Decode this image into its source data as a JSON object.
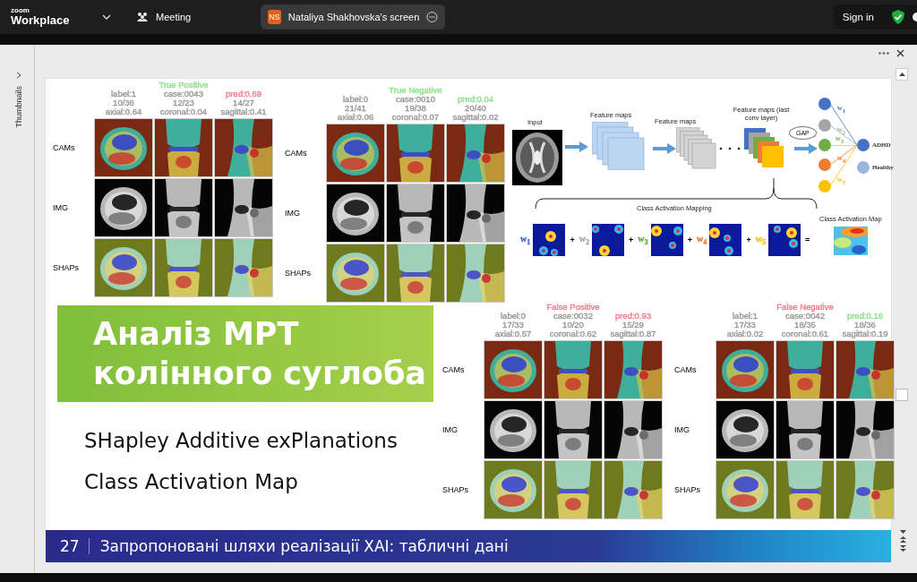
{
  "app_bar": {
    "logo_top": "zoom",
    "logo_bottom": "Workplace",
    "meeting": "Meeting",
    "share": {
      "initials": "NS",
      "label": "Nataliya Shakhovska's screen"
    },
    "sign_in": "Sign in"
  },
  "viewer": {
    "thumbnails": "Thumbnails"
  },
  "slide": {
    "panels": [
      {
        "columns": [
          {
            "lines": [
              {
                "text": "label:1",
                "color": "#9a9a9a"
              },
              {
                "text": "10/36",
                "color": "#9a9a9a"
              },
              {
                "text": "axial:0.64",
                "color": "#9a9a9a"
              }
            ]
          },
          {
            "lines": [
              {
                "text": "True Positive",
                "color": "#8ee08e"
              },
              {
                "text": "case:0043",
                "color": "#9a9a9a"
              },
              {
                "text": "12/23",
                "color": "#9a9a9a"
              },
              {
                "text": "coronal:0.04",
                "color": "#9a9a9a"
              }
            ]
          },
          {
            "lines": [
              {
                "text": "pred:0.69",
                "color": "#f27d8c"
              },
              {
                "text": "14/27",
                "color": "#9a9a9a"
              },
              {
                "text": "sagittal:0.41",
                "color": "#9a9a9a"
              }
            ]
          }
        ],
        "rows": [
          {
            "label": "CAMs",
            "kind": "cam"
          },
          {
            "label": "IMG",
            "kind": "img"
          },
          {
            "label": "SHAPs",
            "kind": "shap"
          }
        ]
      },
      {
        "columns": [
          {
            "lines": [
              {
                "text": "label:0",
                "color": "#9a9a9a"
              },
              {
                "text": "21/41",
                "color": "#9a9a9a"
              },
              {
                "text": "axial:0.06",
                "color": "#9a9a9a"
              }
            ]
          },
          {
            "lines": [
              {
                "text": "True Negative",
                "color": "#8ee08e"
              },
              {
                "text": "case:0010",
                "color": "#9a9a9a"
              },
              {
                "text": "19/38",
                "color": "#9a9a9a"
              },
              {
                "text": "coronal:0.07",
                "color": "#9a9a9a"
              }
            ]
          },
          {
            "lines": [
              {
                "text": "pred:0.04",
                "color": "#8ee08e"
              },
              {
                "text": "20/40",
                "color": "#9a9a9a"
              },
              {
                "text": "sagittal:0.02",
                "color": "#9a9a9a"
              }
            ]
          }
        ],
        "rows": [
          {
            "label": "CAMs",
            "kind": "cam"
          },
          {
            "label": "IMG",
            "kind": "img"
          },
          {
            "label": "SHAPs",
            "kind": "shap"
          }
        ]
      },
      {
        "columns": [
          {
            "lines": [
              {
                "text": "label:0",
                "color": "#9a9a9a"
              },
              {
                "text": "17/33",
                "color": "#9a9a9a"
              },
              {
                "text": "axial:0.57",
                "color": "#9a9a9a"
              }
            ]
          },
          {
            "lines": [
              {
                "text": "False Positive",
                "color": "#f27d8c"
              },
              {
                "text": "case:0032",
                "color": "#9a9a9a"
              },
              {
                "text": "10/20",
                "color": "#9a9a9a"
              },
              {
                "text": "coronal:0.62",
                "color": "#9a9a9a"
              }
            ]
          },
          {
            "lines": [
              {
                "text": "pred:0.93",
                "color": "#f27d8c"
              },
              {
                "text": "15/29",
                "color": "#9a9a9a"
              },
              {
                "text": "sagittal:0.87",
                "color": "#9a9a9a"
              }
            ]
          }
        ],
        "rows": [
          {
            "label": "CAMs",
            "kind": "cam"
          },
          {
            "label": "IMG",
            "kind": "img"
          },
          {
            "label": "SHAPs",
            "kind": "shap"
          }
        ]
      },
      {
        "columns": [
          {
            "lines": [
              {
                "text": "label:1",
                "color": "#9a9a9a"
              },
              {
                "text": "17/33",
                "color": "#9a9a9a"
              },
              {
                "text": "axial:0.02",
                "color": "#9a9a9a"
              }
            ]
          },
          {
            "lines": [
              {
                "text": "False Negative",
                "color": "#f27d8c"
              },
              {
                "text": "case:0042",
                "color": "#9a9a9a"
              },
              {
                "text": "18/35",
                "color": "#9a9a9a"
              },
              {
                "text": "coronal:0.61",
                "color": "#9a9a9a"
              }
            ]
          },
          {
            "lines": [
              {
                "text": "pred:0.16",
                "color": "#8ee08e"
              },
              {
                "text": "18/36",
                "color": "#9a9a9a"
              },
              {
                "text": "sagittal:0.19",
                "color": "#9a9a9a"
              }
            ]
          }
        ],
        "rows": [
          {
            "label": "CAMs",
            "kind": "cam"
          },
          {
            "label": "IMG",
            "kind": "img"
          },
          {
            "label": "SHAPs",
            "kind": "shap"
          }
        ]
      }
    ],
    "diagram": {
      "input_label": "Input",
      "stage_labels": [
        "Feature maps",
        "Feature maps",
        "Feature maps (last conv layer)"
      ],
      "gap": "GAP",
      "nodes": [
        {
          "color": "#4472c4",
          "weight": "w$_{1}$"
        },
        {
          "color": "#a5a5a5",
          "weight": "w$_{2}$"
        },
        {
          "color": "#70ad47",
          "weight": "w$_{3}$"
        },
        {
          "color": "#ed7d31",
          "weight": "w$_{4}$"
        },
        {
          "color": "#ffc000",
          "weight": "w$_{5}$"
        }
      ],
      "outputs": [
        {
          "label": "ADHD",
          "color": "#4472c4"
        },
        {
          "label": "Healthy",
          "color": "#9fb3e0"
        }
      ],
      "mapping_title": "Class Activation Mapping",
      "terms": [
        {
          "weight": "w$_{1}$",
          "color": "#4472c4",
          "operator": "+"
        },
        {
          "weight": "w$_{2}$",
          "color": "#a5a5a5",
          "operator": "+"
        },
        {
          "weight": "w$_{3}$",
          "color": "#70ad47",
          "operator": "+"
        },
        {
          "weight": "w$_{4}$",
          "color": "#ed7d31",
          "operator": "+"
        },
        {
          "weight": "w$_{5}$",
          "color": "#ffc000",
          "operator": "="
        }
      ],
      "result_label": "Class Activation Map"
    },
    "title_lines": [
      "Аналіз МРТ",
      "колінного суглоба"
    ],
    "bullets": [
      "SHapley Additive exPlanations",
      "Class Activation Map"
    ],
    "footer": {
      "number": "27",
      "title": "Запропоновані шляхи реалізації XAI: табличні дані"
    }
  }
}
